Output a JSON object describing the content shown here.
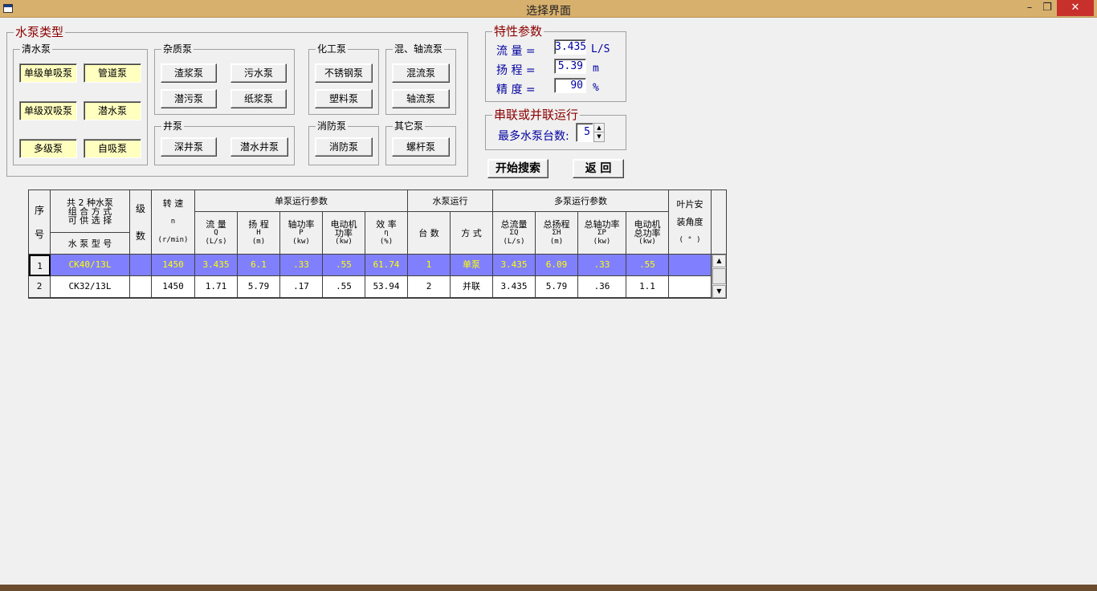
{
  "window": {
    "title": "选择界面",
    "min_icon": "minimize-icon",
    "max_icon": "restore-icon",
    "close_icon": "close-icon"
  },
  "pump_type": {
    "title": "水泵类型",
    "clear_water": {
      "title": "清水泵",
      "buttons": [
        "单级单吸泵",
        "管道泵",
        "单级双吸泵",
        "潜水泵",
        "多级泵",
        "自吸泵"
      ]
    },
    "impurity": {
      "title": "杂质泵",
      "buttons": [
        "渣浆泵",
        "污水泵",
        "潜污泵",
        "纸浆泵"
      ]
    },
    "chemical": {
      "title": "化工泵",
      "buttons": [
        "不锈钢泵",
        "塑料泵"
      ]
    },
    "mixed_axial": {
      "title": "混、轴流泵",
      "buttons": [
        "混流泵",
        "轴流泵"
      ]
    },
    "well": {
      "title": "井泵",
      "buttons": [
        "深井泵",
        "潜水井泵"
      ]
    },
    "fire": {
      "title": "消防泵",
      "buttons": [
        "消防泵"
      ]
    },
    "other": {
      "title": "其它泵",
      "buttons": [
        "螺杆泵"
      ]
    }
  },
  "params": {
    "title": "特性参数",
    "flow_label": "流  量 =",
    "flow_value": "3.435",
    "flow_unit": "L/S",
    "head_label": "扬  程 =",
    "head_value": "5.39",
    "head_unit": "m",
    "precision_label": "精  度 =",
    "precision_value": "90",
    "precision_unit": "%"
  },
  "series": {
    "title": "串联或并联运行",
    "max_label": "最多水泵台数:",
    "max_value": "5"
  },
  "actions": {
    "search": "开始搜索",
    "back": "返  回"
  },
  "grid": {
    "headers": {
      "seq": [
        "序",
        "号"
      ],
      "combo": [
        "共 2 种水泵",
        "组 合 方 式",
        "可 供 选 择"
      ],
      "model": "水 泵 型 号",
      "stage": [
        "级",
        "数"
      ],
      "speed": [
        "转  速",
        "n",
        "(r/min)"
      ],
      "single_group": "单泵运行参数",
      "flow": [
        "流  量",
        "Q",
        "(L/s)"
      ],
      "head": [
        "扬  程",
        "H",
        "(m)"
      ],
      "shaft": [
        "轴功率",
        "P",
        "(kw)"
      ],
      "motor": [
        "电动机",
        "功率",
        "(kw)"
      ],
      "eff": [
        "效  率",
        "η",
        "(%)"
      ],
      "run_group": "水泵运行",
      "count": "台  数",
      "mode": "方  式",
      "multi_group": "多泵运行参数",
      "tflow": [
        "总流量",
        "ΣQ",
        "(L/s)"
      ],
      "thead": [
        "总扬程",
        "ΣH",
        "(m)"
      ],
      "tshaft": [
        "总轴功率",
        "ΣP",
        "(kw)"
      ],
      "tmotor": [
        "电动机",
        "总功率",
        "(kw)"
      ],
      "blade": [
        "叶片安",
        "装角度",
        "( ° )"
      ]
    },
    "rows": [
      {
        "seq": "1",
        "model": "CK40/13L",
        "stage": "",
        "speed": "1450",
        "flow": "3.435",
        "head": "6.1",
        "shaft": ".33",
        "motor": ".55",
        "eff": "61.74",
        "count": "1",
        "mode": "单泵",
        "tflow": "3.435",
        "thead": "6.09",
        "tshaft": ".33",
        "tmotor": ".55",
        "blade": ""
      },
      {
        "seq": "2",
        "model": "CK32/13L",
        "stage": "",
        "speed": "1450",
        "flow": "1.71",
        "head": "5.79",
        "shaft": ".17",
        "motor": ".55",
        "eff": "53.94",
        "count": "2",
        "mode": "并联",
        "tflow": "3.435",
        "thead": "5.79",
        "tshaft": ".36",
        "tmotor": "1.1",
        "blade": ""
      }
    ]
  }
}
